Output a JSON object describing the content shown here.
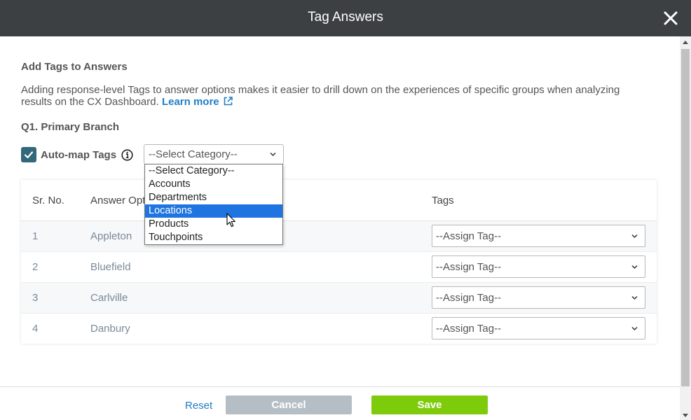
{
  "dialog": {
    "title": "Tag Answers",
    "close_icon": "close-icon"
  },
  "content": {
    "section_title": "Add Tags to Answers",
    "description": "Adding response-level Tags to answer options makes it easier to drill down on the experiences of specific groups when analyzing results on the CX Dashboard.",
    "learn_more_label": "Learn more",
    "question_title": "Q1. Primary Branch",
    "automap": {
      "label": "Auto-map Tags",
      "checked": true
    },
    "category_select": {
      "value": "--Select Category--",
      "options": [
        "--Select Category--",
        "Accounts",
        "Departments",
        "Locations",
        "Products",
        "Touchpoints"
      ],
      "highlighted": "Locations"
    }
  },
  "table": {
    "headers": {
      "sr_no": "Sr. No.",
      "answer_option": "Answer Opt",
      "tags": "Tags"
    },
    "rows": [
      {
        "sr": "1",
        "answer": "Appleton",
        "tag": "--Assign Tag--"
      },
      {
        "sr": "2",
        "answer": "Bluefield",
        "tag": "--Assign Tag--"
      },
      {
        "sr": "3",
        "answer": "Carlville",
        "tag": "--Assign Tag--"
      },
      {
        "sr": "4",
        "answer": "Danbury",
        "tag": "--Assign Tag--"
      }
    ]
  },
  "footer": {
    "reset_label": "Reset",
    "cancel_label": "Cancel",
    "save_label": "Save"
  },
  "colors": {
    "header_bg": "#3d4043",
    "accent_link": "#1f7ec7",
    "checkbox": "#31697a",
    "save": "#7dcb0a",
    "cancel": "#b6bec5",
    "option_highlight": "#1e74e0"
  }
}
